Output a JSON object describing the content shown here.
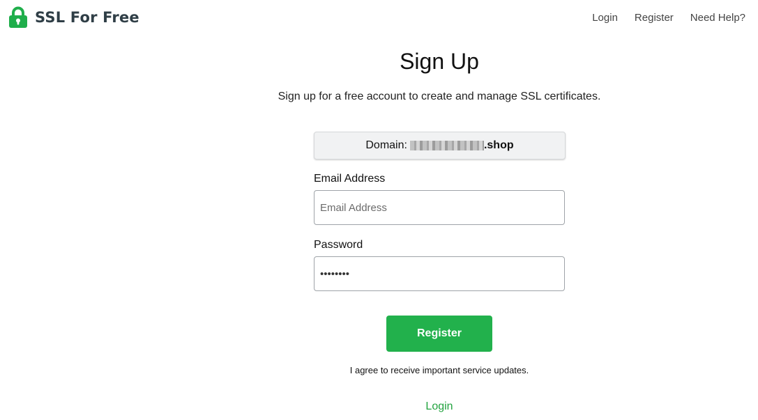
{
  "header": {
    "logo_text": "SSL For Free",
    "nav": [
      {
        "label": "Login"
      },
      {
        "label": "Register"
      },
      {
        "label": "Need Help?"
      }
    ]
  },
  "main": {
    "title": "Sign Up",
    "subtitle": "Sign up for a free account to create and manage SSL certificates.",
    "domain_label": "Domain:",
    "domain_value": ".shop",
    "email": {
      "label": "Email Address",
      "placeholder": "Email Address",
      "value": ""
    },
    "password": {
      "label": "Password",
      "value": "••••••••"
    },
    "register_button": "Register",
    "agree_text": "I agree to receive important service updates.",
    "login_link": "Login"
  },
  "colors": {
    "brand_green": "#22b14c",
    "logo_text": "#2f3e46",
    "link_green": "#22a33f"
  },
  "icons": {
    "logo": "padlock-icon"
  }
}
